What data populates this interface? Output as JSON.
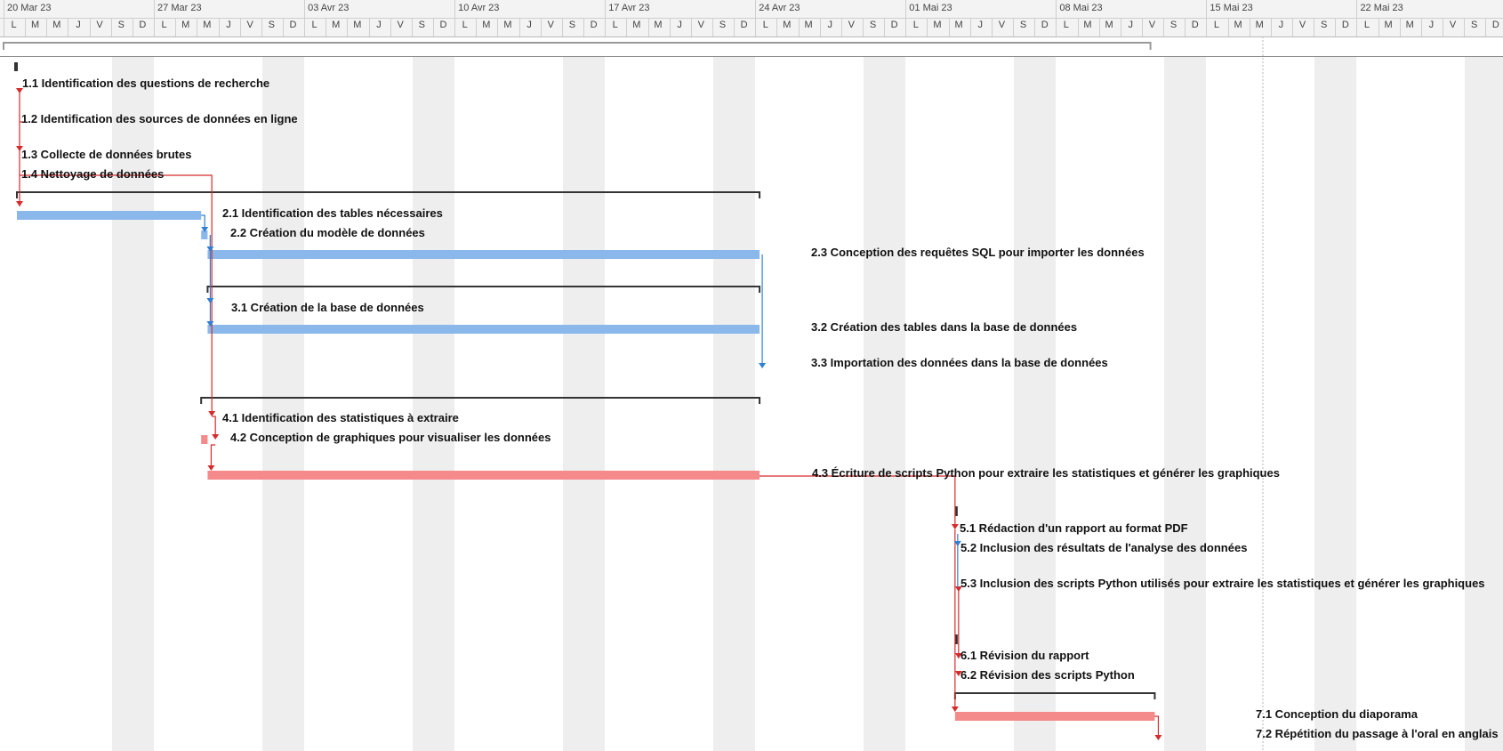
{
  "colors": {
    "critical": "#f58a8a",
    "normal": "#8ab8ea",
    "critical_link": "#d62b2b",
    "normal_link": "#2f7fd6",
    "summary": "#333333",
    "weekend": "#eeeeee"
  },
  "timeline": {
    "weeks": [
      "20 Mar 23",
      "27 Mar 23",
      "03 Avr 23",
      "10 Avr 23",
      "17 Avr 23",
      "24 Avr 23",
      "01 Mai 23",
      "08 Mai 23",
      "15 Mai 23",
      "22 Mai 23"
    ],
    "days": [
      "L",
      "M",
      "M",
      "J",
      "V",
      "S",
      "D"
    ]
  },
  "tasks": [
    {
      "id": "1.1",
      "label": "1.1 Identification des questions de recherche"
    },
    {
      "id": "1.2",
      "label": "1.2 Identification des sources de données en ligne"
    },
    {
      "id": "1.3",
      "label": "1.3 Collecte de données brutes"
    },
    {
      "id": "1.4",
      "label": "1.4 Nettoyage de données"
    },
    {
      "id": "2.1",
      "label": "2.1 Identification des tables nécessaires"
    },
    {
      "id": "2.2",
      "label": "2.2 Création du modèle de données"
    },
    {
      "id": "2.3",
      "label": "2.3 Conception des requêtes SQL pour importer les données"
    },
    {
      "id": "3.1",
      "label": "3.1 Création de la base de données"
    },
    {
      "id": "3.2",
      "label": "3.2 Création des tables dans la base de données"
    },
    {
      "id": "3.3",
      "label": "3.3 Importation des données dans la base de données"
    },
    {
      "id": "4.1",
      "label": "4.1 Identification des statistiques à extraire"
    },
    {
      "id": "4.2",
      "label": "4.2 Conception de graphiques pour visualiser les données"
    },
    {
      "id": "4.3",
      "label": "4.3 Écriture de scripts Python pour extraire les statistiques et générer les graphiques"
    },
    {
      "id": "5.1",
      "label": "5.1 Rédaction d'un rapport au format PDF"
    },
    {
      "id": "5.2",
      "label": "5.2 Inclusion des résultats de l'analyse des données"
    },
    {
      "id": "5.3",
      "label": "5.3 Inclusion des scripts Python utilisés pour extraire les statistiques et générer les graphiques"
    },
    {
      "id": "6.1",
      "label": "6.1 Révision du rapport"
    },
    {
      "id": "6.2",
      "label": "6.2 Révision des scripts Python"
    },
    {
      "id": "7.1",
      "label": "7.1 Conception du diaporama"
    },
    {
      "id": "7.2",
      "label": "7.2 Répétition du passage à l'oral en anglais"
    }
  ]
}
